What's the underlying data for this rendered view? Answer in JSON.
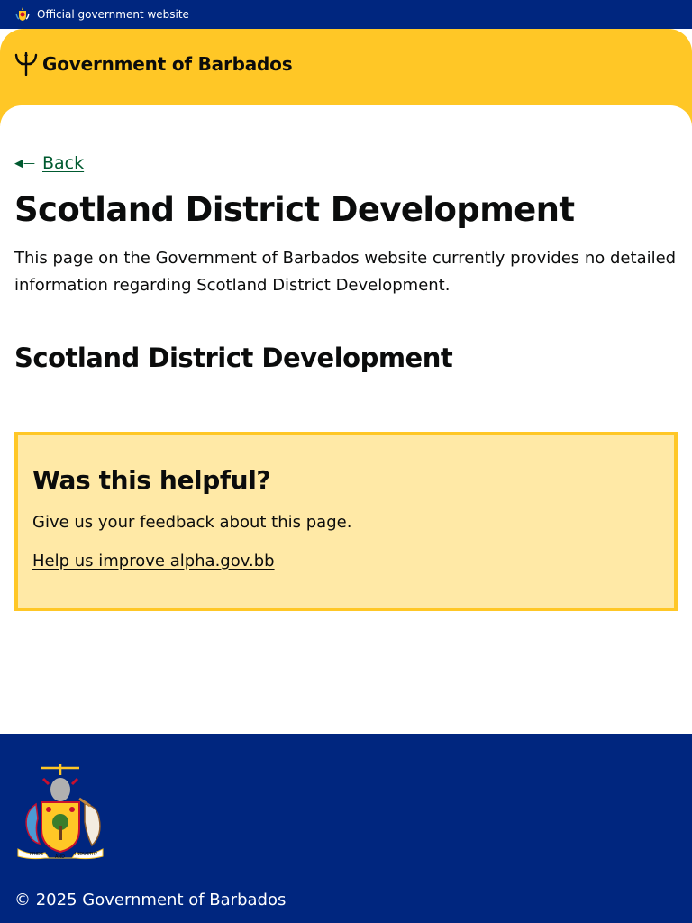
{
  "official_bar": {
    "text": "Official government website",
    "icon": "coat-of-arms-icon"
  },
  "header": {
    "logo_text": "Government of Barbados",
    "logo_icon": "trident-icon"
  },
  "navigation": {
    "back_label": "Back",
    "back_icon": "back-arrow-icon"
  },
  "main": {
    "title": "Scotland District Development",
    "intro": "This page on the Government of Barbados website currently provides no detailed information regarding Scotland District Development.",
    "subheading": "Scotland District Development"
  },
  "feedback": {
    "heading": "Was this helpful?",
    "text": "Give us your feedback about this page.",
    "link_label": "Help us improve alpha.gov.bb"
  },
  "footer": {
    "crest_motto_left": "PRIDE",
    "crest_motto_middle": "AND",
    "crest_motto_right": "INDUSTRY",
    "copyright": "© 2025 Government of Barbados"
  },
  "colors": {
    "navy": "#00267f",
    "yellow": "#ffc726",
    "feedback_bg": "#ffe9a6",
    "link_green": "#005a30"
  }
}
